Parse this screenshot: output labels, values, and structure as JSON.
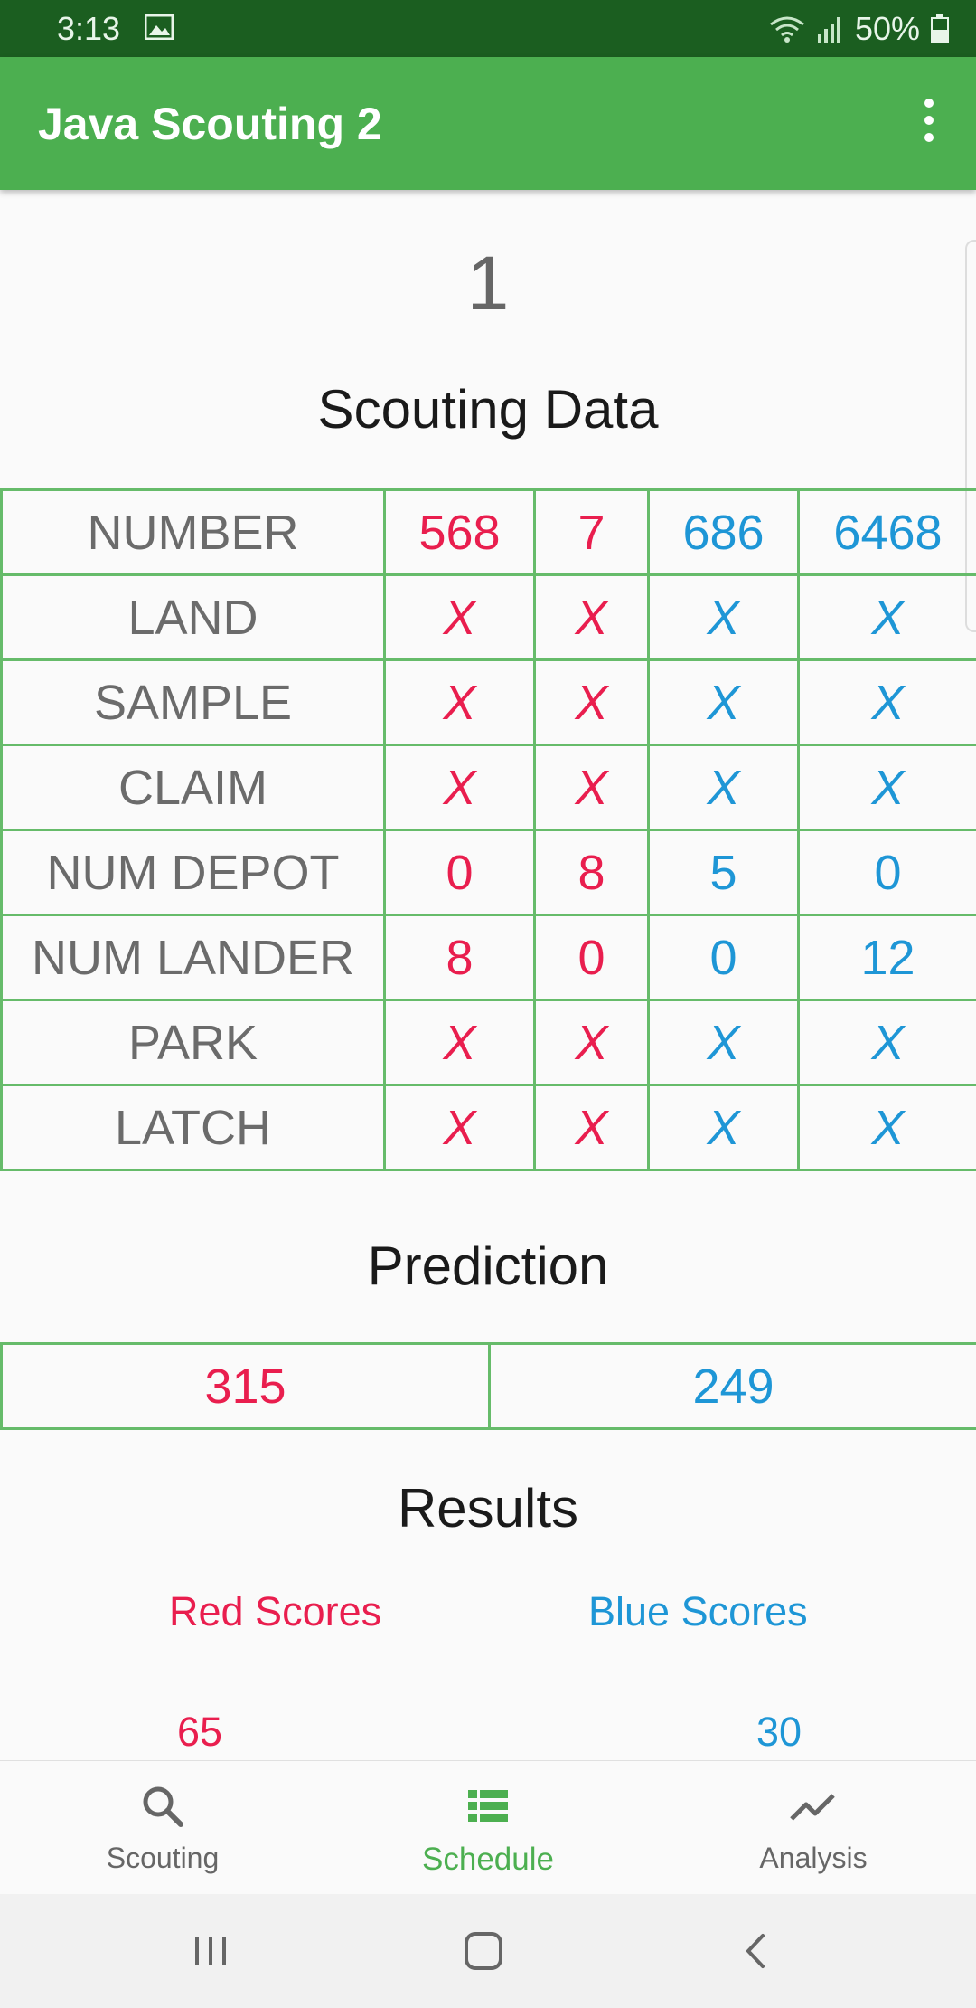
{
  "status_bar": {
    "time": "3:13",
    "battery": "50%"
  },
  "app_bar": {
    "title": "Java Scouting 2"
  },
  "match_number": "1",
  "scouting": {
    "title": "Scouting Data",
    "rows": [
      {
        "label": "NUMBER",
        "values": [
          "568",
          "7",
          "686",
          "6468"
        ]
      },
      {
        "label": "LAND",
        "values": [
          "X",
          "X",
          "X",
          "X"
        ]
      },
      {
        "label": "SAMPLE",
        "values": [
          "X",
          "X",
          "X",
          "X"
        ]
      },
      {
        "label": "CLAIM",
        "values": [
          "X",
          "X",
          "X",
          "X"
        ]
      },
      {
        "label": "NUM DEPOT",
        "values": [
          "0",
          "8",
          "5",
          "0"
        ]
      },
      {
        "label": "NUM LANDER",
        "values": [
          "8",
          "0",
          "0",
          "12"
        ]
      },
      {
        "label": "PARK",
        "values": [
          "X",
          "X",
          "X",
          "X"
        ]
      },
      {
        "label": "LATCH",
        "values": [
          "X",
          "X",
          "X",
          "X"
        ]
      }
    ]
  },
  "prediction": {
    "title": "Prediction",
    "red": "315",
    "blue": "249"
  },
  "results": {
    "title": "Results",
    "red_label": "Red Scores",
    "blue_label": "Blue Scores",
    "red_score": "65",
    "blue_score": "30"
  },
  "bottom_nav": [
    {
      "label": "Scouting",
      "icon": "search-icon",
      "active": false
    },
    {
      "label": "Schedule",
      "icon": "list-icon",
      "active": true
    },
    {
      "label": "Analysis",
      "icon": "trending-icon",
      "active": false
    }
  ],
  "colors": {
    "red_alliance": "#e91e4e",
    "blue_alliance": "#1e96d6",
    "accent": "#4caf50"
  }
}
